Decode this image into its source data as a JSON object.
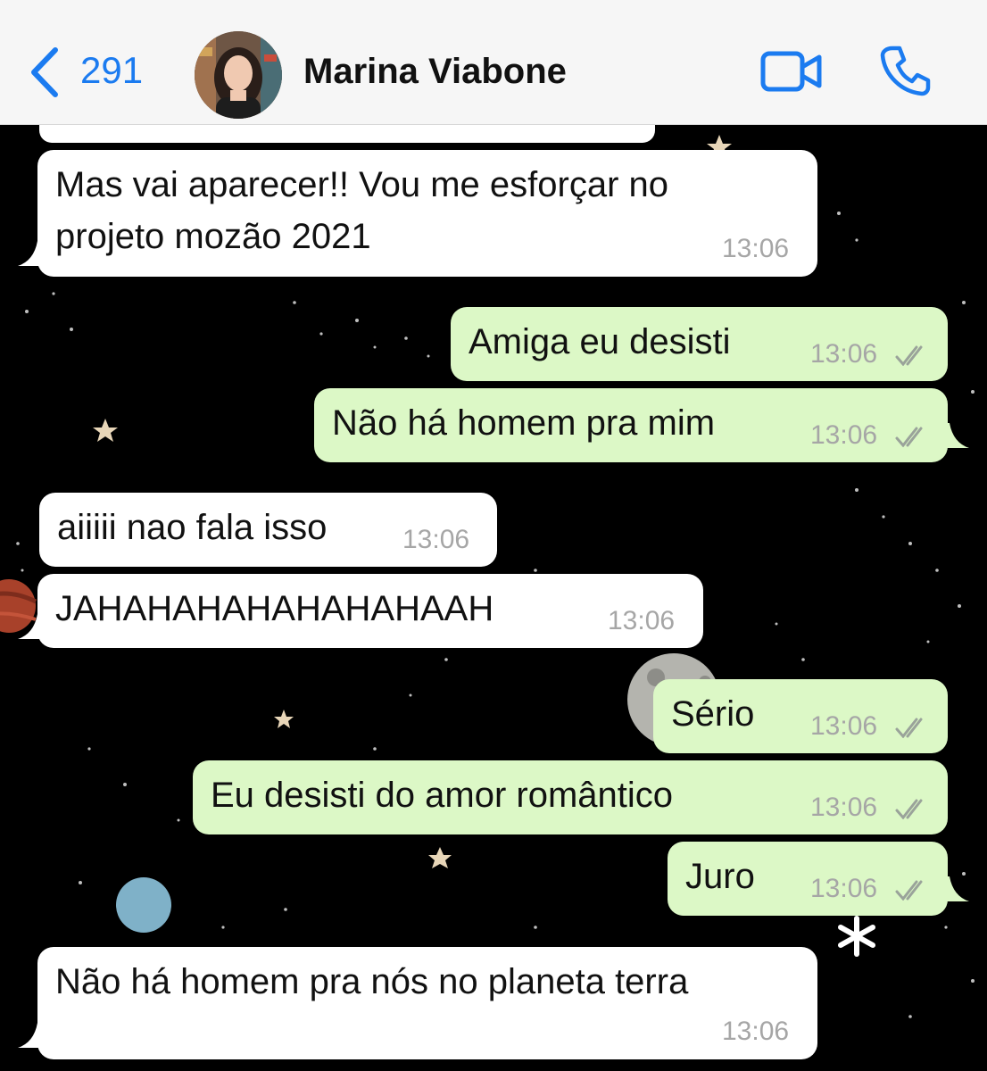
{
  "header": {
    "back_count": "291",
    "contact_name": "Marina Viabone"
  },
  "colors": {
    "accent": "#1b7bf0",
    "incoming_bubble": "#ffffff",
    "outgoing_bubble": "#dcf8c6",
    "background": "#000000"
  },
  "icons": [
    "chevron-left-icon",
    "video-call-icon",
    "phone-icon",
    "double-check-icon"
  ],
  "messages": [
    {
      "direction": "incoming",
      "text": "Mas vai aparecer!! Vou me esforçar no projeto mozão 2021",
      "time": "13:06"
    },
    {
      "direction": "outgoing",
      "text": "Amiga eu desisti",
      "time": "13:06"
    },
    {
      "direction": "outgoing",
      "text": "Não há homem pra mim",
      "time": "13:06"
    },
    {
      "direction": "incoming",
      "text": "aiiiii nao fala isso",
      "time": "13:06"
    },
    {
      "direction": "incoming",
      "text": "JAHAHAHAHAHAHAHAAH",
      "time": "13:06"
    },
    {
      "direction": "outgoing",
      "text": "Sério",
      "time": "13:06"
    },
    {
      "direction": "outgoing",
      "text": "Eu desisti do amor romântico",
      "time": "13:06"
    },
    {
      "direction": "outgoing",
      "text": "Juro",
      "time": "13:06"
    },
    {
      "direction": "incoming",
      "text": "Não há homem pra nós no planeta terra",
      "time": "13:06"
    }
  ]
}
